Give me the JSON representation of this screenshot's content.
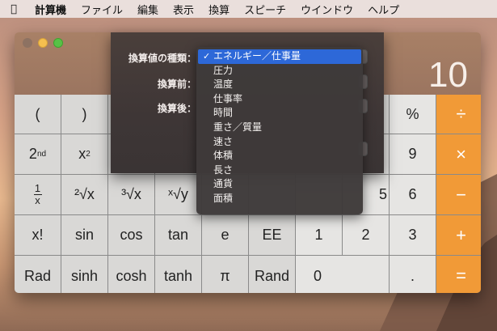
{
  "menubar": {
    "apple_icon": "apple-icon",
    "app_name": "計算機",
    "items": [
      "ファイル",
      "編集",
      "表示",
      "換算",
      "スピーチ",
      "ウインドウ",
      "ヘルプ"
    ]
  },
  "calculator": {
    "display": "10",
    "keys": {
      "open_paren": "(",
      "close_paren": ")",
      "x2": "x",
      "x2_sup": "2",
      "second": "2",
      "second_sup": "nd",
      "recip_num": "1",
      "recip_den": "x",
      "sqrt2": "²√x",
      "sqrt3": "³√x",
      "sqrty": "ˣ√y",
      "percent": "%",
      "divide": "÷",
      "nine": "9",
      "multiply": "×",
      "five_partial": "5",
      "six": "6",
      "minus": "−",
      "factorial": "x!",
      "sin": "sin",
      "cos": "cos",
      "tan": "tan",
      "e": "e",
      "ee": "EE",
      "one": "1",
      "two": "2",
      "three": "3",
      "plus": "+",
      "rad": "Rad",
      "sinh": "sinh",
      "cosh": "cosh",
      "tanh": "tanh",
      "pi": "π",
      "rand": "Rand",
      "zero": "0",
      "dot": ".",
      "equals": "="
    }
  },
  "conversion_sheet": {
    "label_type": "換算値の種類：",
    "label_before": "換算前：",
    "label_after": "換算後："
  },
  "dropdown": {
    "check_icon": "checkmark-icon",
    "items": [
      "エネルギー／仕事量",
      "圧力",
      "温度",
      "仕事率",
      "時間",
      "重さ／質量",
      "速さ",
      "体積",
      "長さ",
      "通貨",
      "面積"
    ],
    "selected_index": 0
  },
  "colors": {
    "operator": "#f19a37",
    "selection": "#2d68d8"
  }
}
